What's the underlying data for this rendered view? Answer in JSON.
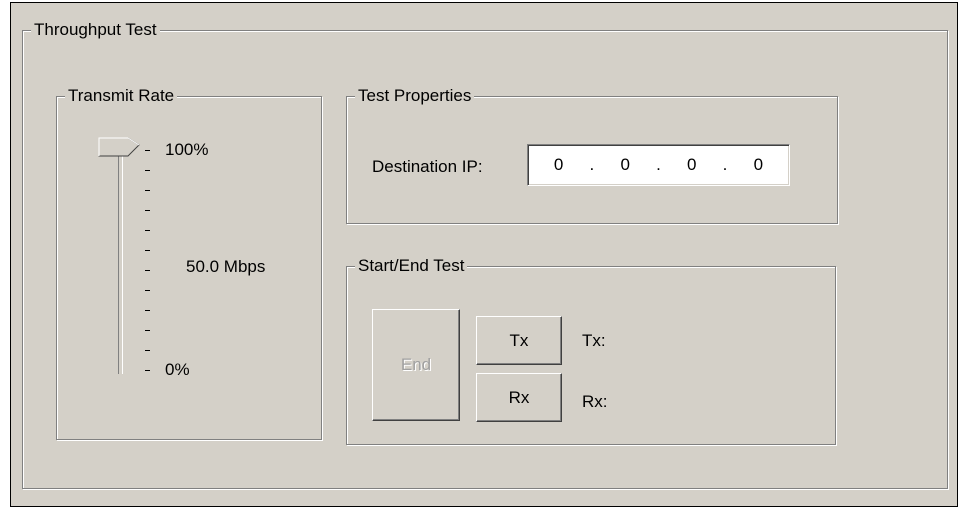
{
  "throughput_group": {
    "title": "Throughput Test"
  },
  "transmit_rate": {
    "title": "Transmit Rate",
    "max_label": "100%",
    "min_label": "0%",
    "rate_value": "50.0 Mbps",
    "slider_level_percent": 100
  },
  "test_properties": {
    "title": "Test Properties",
    "destination_label": "Destination IP:",
    "ip_octets": [
      "0",
      "0",
      "0",
      "0"
    ]
  },
  "start_end": {
    "title": "Start/End Test",
    "end_label": "End",
    "tx_button_label": "Tx",
    "rx_button_label": "Rx",
    "tx_status_label": "Tx:",
    "rx_status_label": "Rx:"
  }
}
